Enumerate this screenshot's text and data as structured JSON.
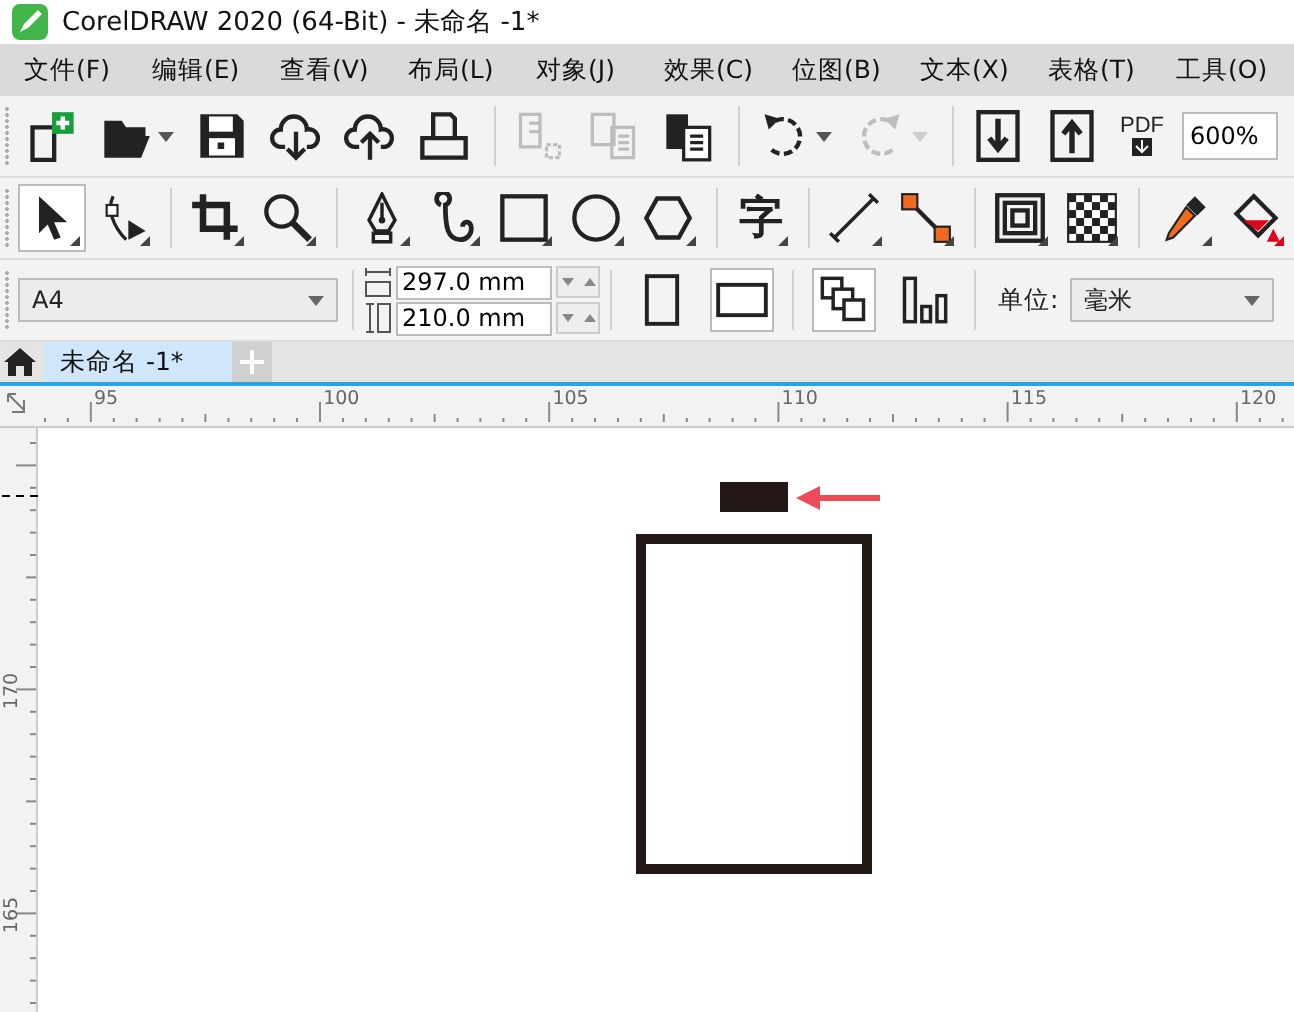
{
  "window": {
    "title": "CorelDRAW 2020 (64-Bit) - 未命名 -1*"
  },
  "menu": [
    "文件(F)",
    "编辑(E)",
    "查看(V)",
    "布局(L)",
    "对象(J)",
    "效果(C)",
    "位图(B)",
    "文本(X)",
    "表格(T)",
    "工具(O)"
  ],
  "standard_toolbar": {
    "groups": [
      [
        {
          "kind": "new",
          "disabled": false,
          "dropdown": false
        },
        {
          "kind": "open",
          "disabled": false,
          "dropdown": true
        },
        {
          "kind": "save",
          "disabled": false,
          "dropdown": false
        },
        {
          "kind": "cloud-down",
          "disabled": false,
          "dropdown": false
        },
        {
          "kind": "cloud-up",
          "disabled": false,
          "dropdown": false
        },
        {
          "kind": "print",
          "disabled": false,
          "dropdown": false
        }
      ],
      [
        {
          "kind": "copy-props",
          "disabled": true,
          "dropdown": false
        },
        {
          "kind": "copy-doc",
          "disabled": true,
          "dropdown": false
        },
        {
          "kind": "paste",
          "disabled": false,
          "dropdown": false
        }
      ],
      [
        {
          "kind": "undo",
          "disabled": false,
          "dropdown": true
        },
        {
          "kind": "redo",
          "disabled": true,
          "dropdown": true
        }
      ],
      [
        {
          "kind": "import",
          "disabled": false,
          "dropdown": false
        },
        {
          "kind": "export",
          "disabled": false,
          "dropdown": false
        },
        {
          "kind": "pdf",
          "label": "PDF",
          "disabled": false,
          "dropdown": false
        }
      ]
    ],
    "zoom": "600%"
  },
  "toolbox": [
    [
      {
        "kind": "pick",
        "selected": true
      },
      {
        "kind": "shape",
        "selected": false
      }
    ],
    [
      {
        "kind": "crop",
        "selected": false
      },
      {
        "kind": "zoom",
        "selected": false
      }
    ],
    [
      {
        "kind": "pen",
        "selected": false
      },
      {
        "kind": "curve",
        "selected": false
      },
      {
        "kind": "rect",
        "selected": false
      },
      {
        "kind": "ellipse",
        "selected": false
      },
      {
        "kind": "polygon",
        "selected": false
      }
    ],
    [
      {
        "kind": "text",
        "label": "字",
        "selected": false
      }
    ],
    [
      {
        "kind": "dimension",
        "selected": false
      },
      {
        "kind": "connector",
        "selected": false
      }
    ],
    [
      {
        "kind": "contour",
        "selected": false
      },
      {
        "kind": "transparency",
        "selected": false
      }
    ],
    [
      {
        "kind": "eyedropper",
        "selected": false
      },
      {
        "kind": "fill",
        "selected": false
      }
    ]
  ],
  "property_bar": {
    "page_size": "A4",
    "width": "297.0 mm",
    "height": "210.0 mm",
    "orientation": [
      {
        "kind": "portrait",
        "selected": false
      },
      {
        "kind": "landscape",
        "selected": true
      }
    ],
    "page_scope": [
      {
        "kind": "all-pages",
        "selected": true
      },
      {
        "kind": "current-page",
        "selected": false
      }
    ],
    "units_label": "单位:",
    "units": "毫米"
  },
  "tabs": [
    {
      "label": "未命名 -1*",
      "selected": true
    }
  ],
  "rulers": {
    "horizontal": [
      "95",
      "100",
      "105",
      "110",
      "115",
      "120"
    ],
    "vertical": [
      "170",
      "165"
    ]
  }
}
